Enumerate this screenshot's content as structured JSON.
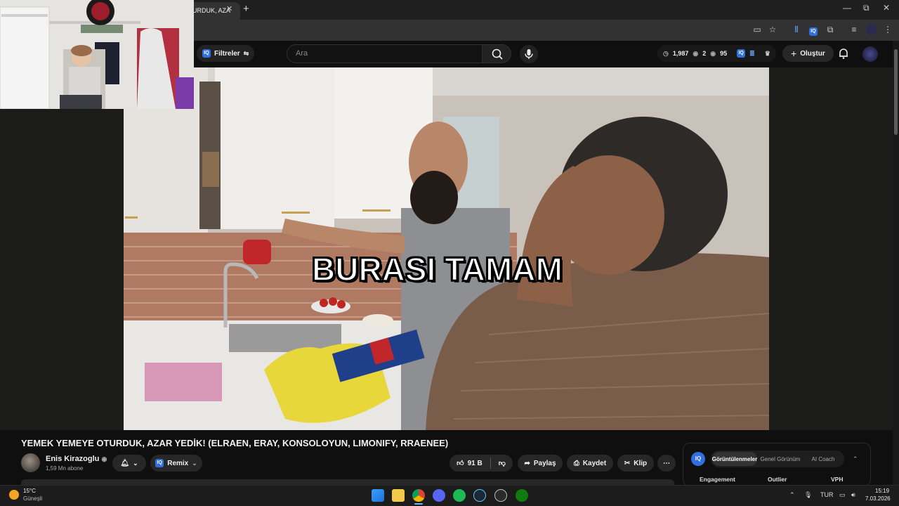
{
  "browser": {
    "tab_title": "URDUK, AZA",
    "tab_close": "✕",
    "new_tab": "+",
    "window_controls": [
      "—",
      "⧉",
      "✕"
    ]
  },
  "header": {
    "filters_label": "Filtreler",
    "search_placeholder": "Ara",
    "stats": {
      "views": "1,987",
      "eye_a": "2",
      "eye_b": "95"
    },
    "create_label": "Oluştur"
  },
  "video": {
    "subtitle": "BURASI TAMAM",
    "title": "YEMEK YEMEYE OTURDUK, AZAR YEDİK! (ELRAEN, ERAY, KONSOLOYUN, LIMONIFY, RRAENEE)"
  },
  "channel": {
    "name": "Enis Kirazoglu",
    "subscribers": "1,59 Mn abone",
    "remix_label": "Remix"
  },
  "actions": {
    "likes": "91 B",
    "share": "Paylaş",
    "save": "Kaydet",
    "clip": "Klip",
    "more": "⋯"
  },
  "panel": {
    "tabs": [
      "Görüntülenmeler",
      "Genel Görünüm",
      "AI Coach"
    ],
    "columns": [
      "Engagement",
      "Outlier",
      "VPH"
    ]
  },
  "taskbar": {
    "weather_temp": "15°C",
    "weather_desc": "Güneşli",
    "language": "TUR",
    "time": "15:19",
    "date": "7.03.2026"
  },
  "colors": {
    "accent_blue": "#2f6fe0",
    "bg": "#0f0f0f",
    "pill": "#272727"
  }
}
